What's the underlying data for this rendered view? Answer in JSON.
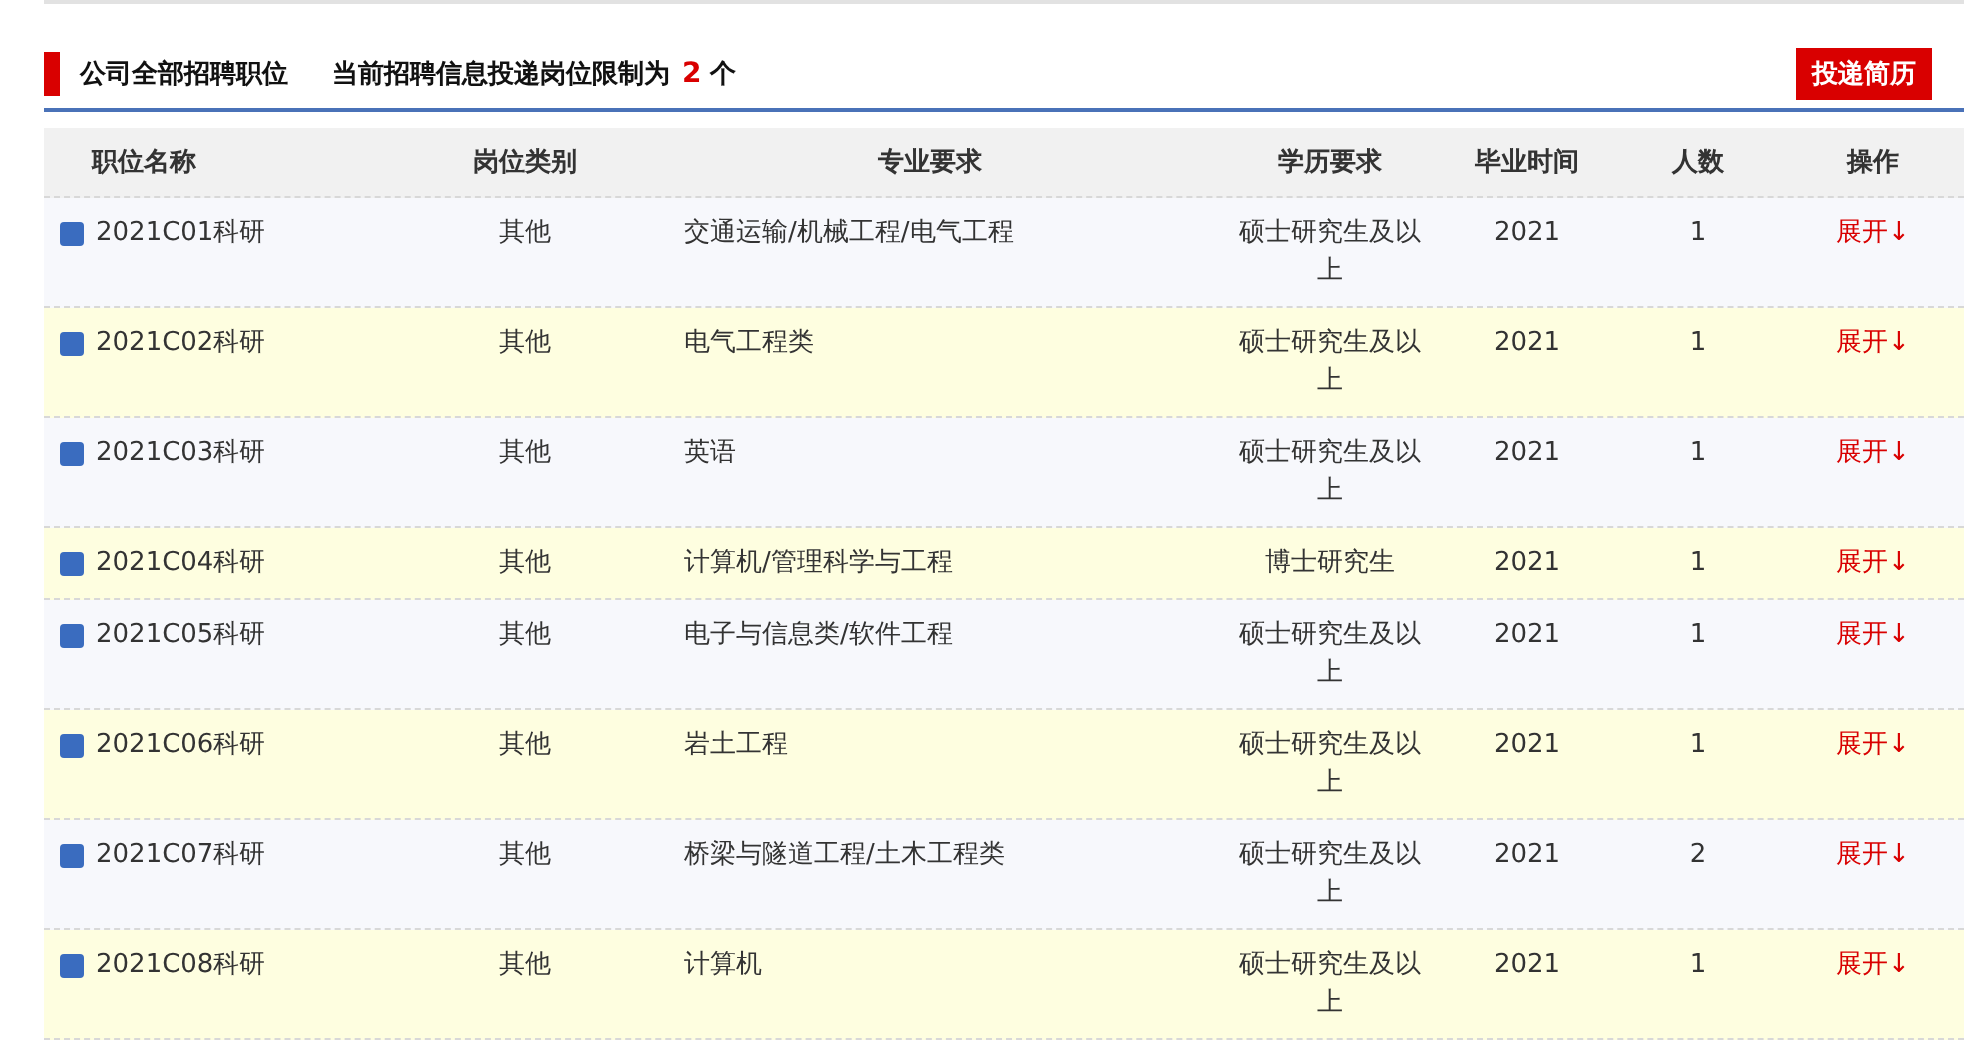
{
  "header": {
    "title": "公司全部招聘职位",
    "notice": "当前招聘信息投递岗位限制为",
    "limit": "2",
    "unit": "个",
    "button": "投递简历"
  },
  "table": {
    "columns": [
      "职位名称",
      "岗位类别",
      "专业要求",
      "学历要求",
      "毕业时间",
      "人数",
      "操作"
    ],
    "rows": [
      {
        "name": "2021C01科研",
        "category": "其他",
        "major": "交通运输/机械工程/电气工程",
        "education": "硕士研究生及以上",
        "year": "2021",
        "count": "1",
        "action": "展开↓"
      },
      {
        "name": "2021C02科研",
        "category": "其他",
        "major": "电气工程类",
        "education": "硕士研究生及以上",
        "year": "2021",
        "count": "1",
        "action": "展开↓"
      },
      {
        "name": "2021C03科研",
        "category": "其他",
        "major": "英语",
        "education": "硕士研究生及以上",
        "year": "2021",
        "count": "1",
        "action": "展开↓"
      },
      {
        "name": "2021C04科研",
        "category": "其他",
        "major": "计算机/管理科学与工程",
        "education": "博士研究生",
        "year": "2021",
        "count": "1",
        "action": "展开↓"
      },
      {
        "name": "2021C05科研",
        "category": "其他",
        "major": "电子与信息类/软件工程",
        "education": "硕士研究生及以上",
        "year": "2021",
        "count": "1",
        "action": "展开↓"
      },
      {
        "name": "2021C06科研",
        "category": "其他",
        "major": "岩土工程",
        "education": "硕士研究生及以上",
        "year": "2021",
        "count": "1",
        "action": "展开↓"
      },
      {
        "name": "2021C07科研",
        "category": "其他",
        "major": "桥梁与隧道工程/土木工程类",
        "education": "硕士研究生及以上",
        "year": "2021",
        "count": "2",
        "action": "展开↓"
      },
      {
        "name": "2021C08科研",
        "category": "其他",
        "major": "计算机",
        "education": "硕士研究生及以上",
        "year": "2021",
        "count": "1",
        "action": "展开↓"
      }
    ]
  }
}
